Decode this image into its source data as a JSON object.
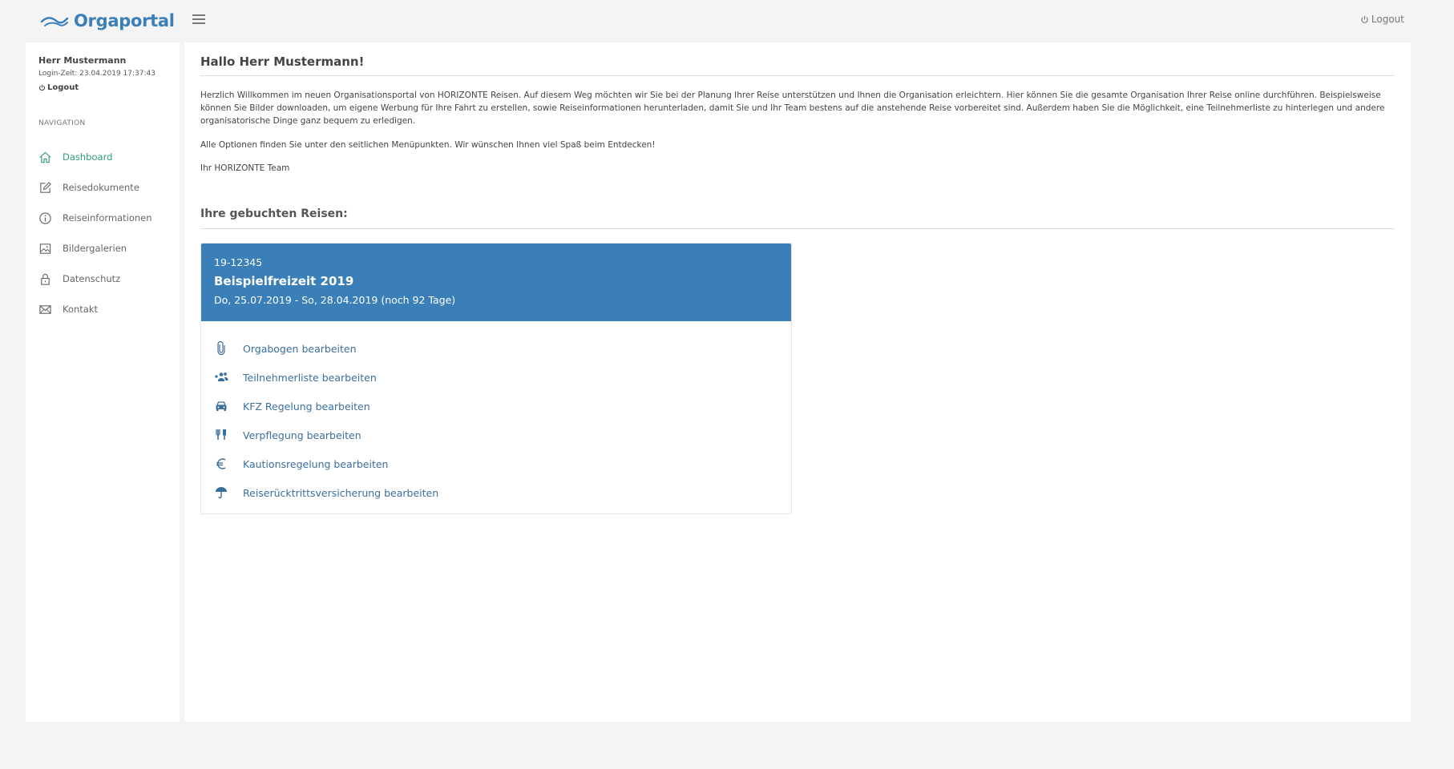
{
  "header": {
    "brand": "Orgaportal",
    "logout_label": "Logout"
  },
  "sidebar": {
    "user_name": "Herr Mustermann",
    "login_time": "Login-Zeit: 23.04.2019 17:37:43",
    "logout_label": "Logout",
    "nav_heading": "NAVIGATION",
    "items": [
      {
        "label": "Dashboard",
        "icon": "home-icon",
        "active": true
      },
      {
        "label": "Reisedokumente",
        "icon": "edit-icon"
      },
      {
        "label": "Reiseinformationen",
        "icon": "info-icon"
      },
      {
        "label": "Bildergalerien",
        "icon": "image-icon"
      },
      {
        "label": "Datenschutz",
        "icon": "lock-icon"
      },
      {
        "label": "Kontakt",
        "icon": "mail-icon"
      }
    ]
  },
  "main": {
    "greeting": "Hallo Herr Mustermann!",
    "intro": "Herzlich Willkommen im neuen Organisationsportal von HORIZONTE Reisen. Auf diesem Weg möchten wir Sie bei der Planung Ihrer Reise unterstützen und Ihnen die Organisation erleichtern. Hier können Sie die gesamte Organisation Ihrer Reise online durchführen. Beispielsweise können Sie Bilder downloaden, um eigene Werbung für Ihre Fahrt zu erstellen, sowie Reiseinformationen herunterladen, damit Sie und Ihr Team bestens auf die anstehende Reise vorbereitet sind. Außerdem haben Sie die Möglichkeit, eine Teilnehmerliste zu hinterlegen und andere organisatorische Dinge ganz bequem zu erledigen.",
    "options_text": "Alle Optionen finden Sie unter den seitlichen Menüpunkten. Wir wünschen Ihnen viel Spaß beim Entdecken!",
    "signature": "Ihr HORIZONTE Team",
    "booked_title": "Ihre gebuchten Reisen:",
    "trip": {
      "number": "19-12345",
      "title": "Beispielfreizeit 2019",
      "dates": "Do, 25.07.2019 - So, 28.04.2019 (noch 92 Tage)",
      "header_color": "#3a7fb8",
      "actions": [
        {
          "label": "Orgabogen bearbeiten",
          "icon": "paperclip-icon"
        },
        {
          "label": "Teilnehmerliste bearbeiten",
          "icon": "add-users-icon"
        },
        {
          "label": "KFZ Regelung bearbeiten",
          "icon": "car-icon"
        },
        {
          "label": "Verpflegung bearbeiten",
          "icon": "utensils-icon"
        },
        {
          "label": "Kautionsregelung bearbeiten",
          "icon": "euro-icon"
        },
        {
          "label": "Reiserücktrittsversicherung bearbeiten",
          "icon": "umbrella-icon"
        }
      ]
    }
  }
}
